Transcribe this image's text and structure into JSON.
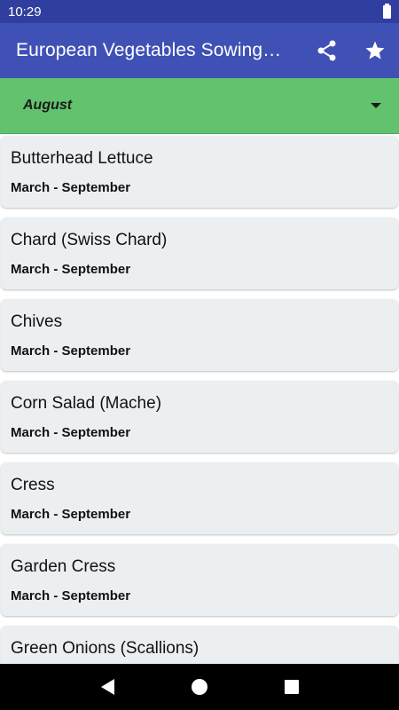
{
  "status_bar": {
    "time": "10:29"
  },
  "app_bar": {
    "title": "European Vegetables Sowing…",
    "actions": [
      {
        "icon": "share-icon"
      },
      {
        "icon": "star-icon"
      }
    ]
  },
  "month_selector": {
    "selected": "August"
  },
  "vegetables": [
    {
      "name": "Butterhead Lettuce",
      "range": "March - September"
    },
    {
      "name": "Chard (Swiss Chard)",
      "range": "March - September"
    },
    {
      "name": "Chives",
      "range": "March - September"
    },
    {
      "name": "Corn Salad (Mache)",
      "range": "March - September"
    },
    {
      "name": "Cress",
      "range": "March - September"
    },
    {
      "name": "Garden Cress",
      "range": "March - September"
    },
    {
      "name": "Green Onions (Scallions)",
      "range": ""
    }
  ],
  "colors": {
    "status_bar": "#303f9f",
    "app_bar": "#3f51b5",
    "month_bar": "#62c26d",
    "card": "#eceff1"
  }
}
